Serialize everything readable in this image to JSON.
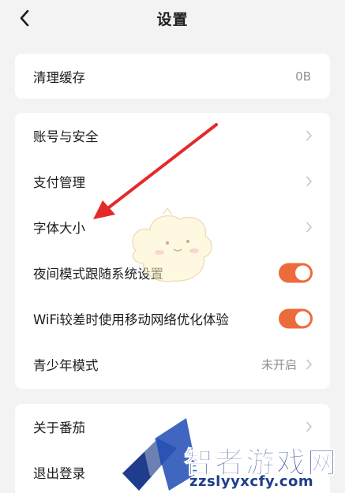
{
  "navbar": {
    "title": "设置"
  },
  "card1": {
    "items": [
      {
        "label": "清理缓存",
        "value": "0B"
      }
    ]
  },
  "card2": {
    "items": [
      {
        "label": "账号与安全"
      },
      {
        "label": "支付管理"
      },
      {
        "label": "字体大小"
      },
      {
        "label": "夜间模式跟随系统设置",
        "toggle": true
      },
      {
        "label": "WiFi较差时使用移动网络优化体验",
        "toggle": true
      },
      {
        "label": "青少年模式",
        "value": "未开启"
      }
    ]
  },
  "card3": {
    "items": [
      {
        "label": "关于番茄"
      },
      {
        "label": "退出登录"
      }
    ]
  },
  "colors": {
    "accent": "#ec6b3c",
    "arrow": "#e52a2a",
    "watermark": "#1f3d8c"
  },
  "watermark": {
    "text": "智者游戏网",
    "url": "zzslyyxcfy.com"
  }
}
